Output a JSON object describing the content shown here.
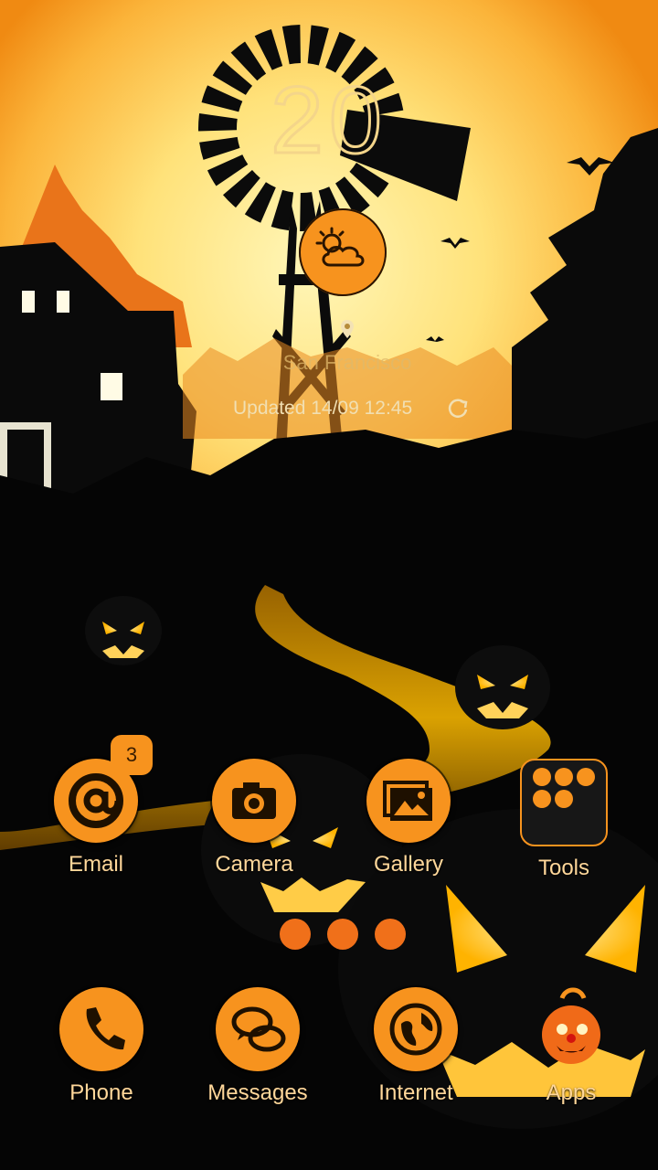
{
  "clock": {
    "time": "20"
  },
  "weather": {
    "icon": "partly-cloudy-icon",
    "city": "San Francisco",
    "updated": "Updated 14/09 12:45"
  },
  "apps": [
    {
      "label": "Email",
      "icon": "at-sign-icon",
      "badge": "3"
    },
    {
      "label": "Camera",
      "icon": "camera-icon"
    },
    {
      "label": "Gallery",
      "icon": "gallery-icon"
    },
    {
      "label": "Tools",
      "icon": "folder-icon"
    }
  ],
  "dock": [
    {
      "label": "Phone",
      "icon": "phone-icon"
    },
    {
      "label": "Messages",
      "icon": "chat-bubbles-icon"
    },
    {
      "label": "Internet",
      "icon": "globe-icon"
    },
    {
      "label": "Apps",
      "icon": "pumpkin-clown-icon"
    }
  ],
  "colors": {
    "accent": "#f7931e",
    "label": "#ffd79a",
    "sky": "#fff1a6"
  }
}
